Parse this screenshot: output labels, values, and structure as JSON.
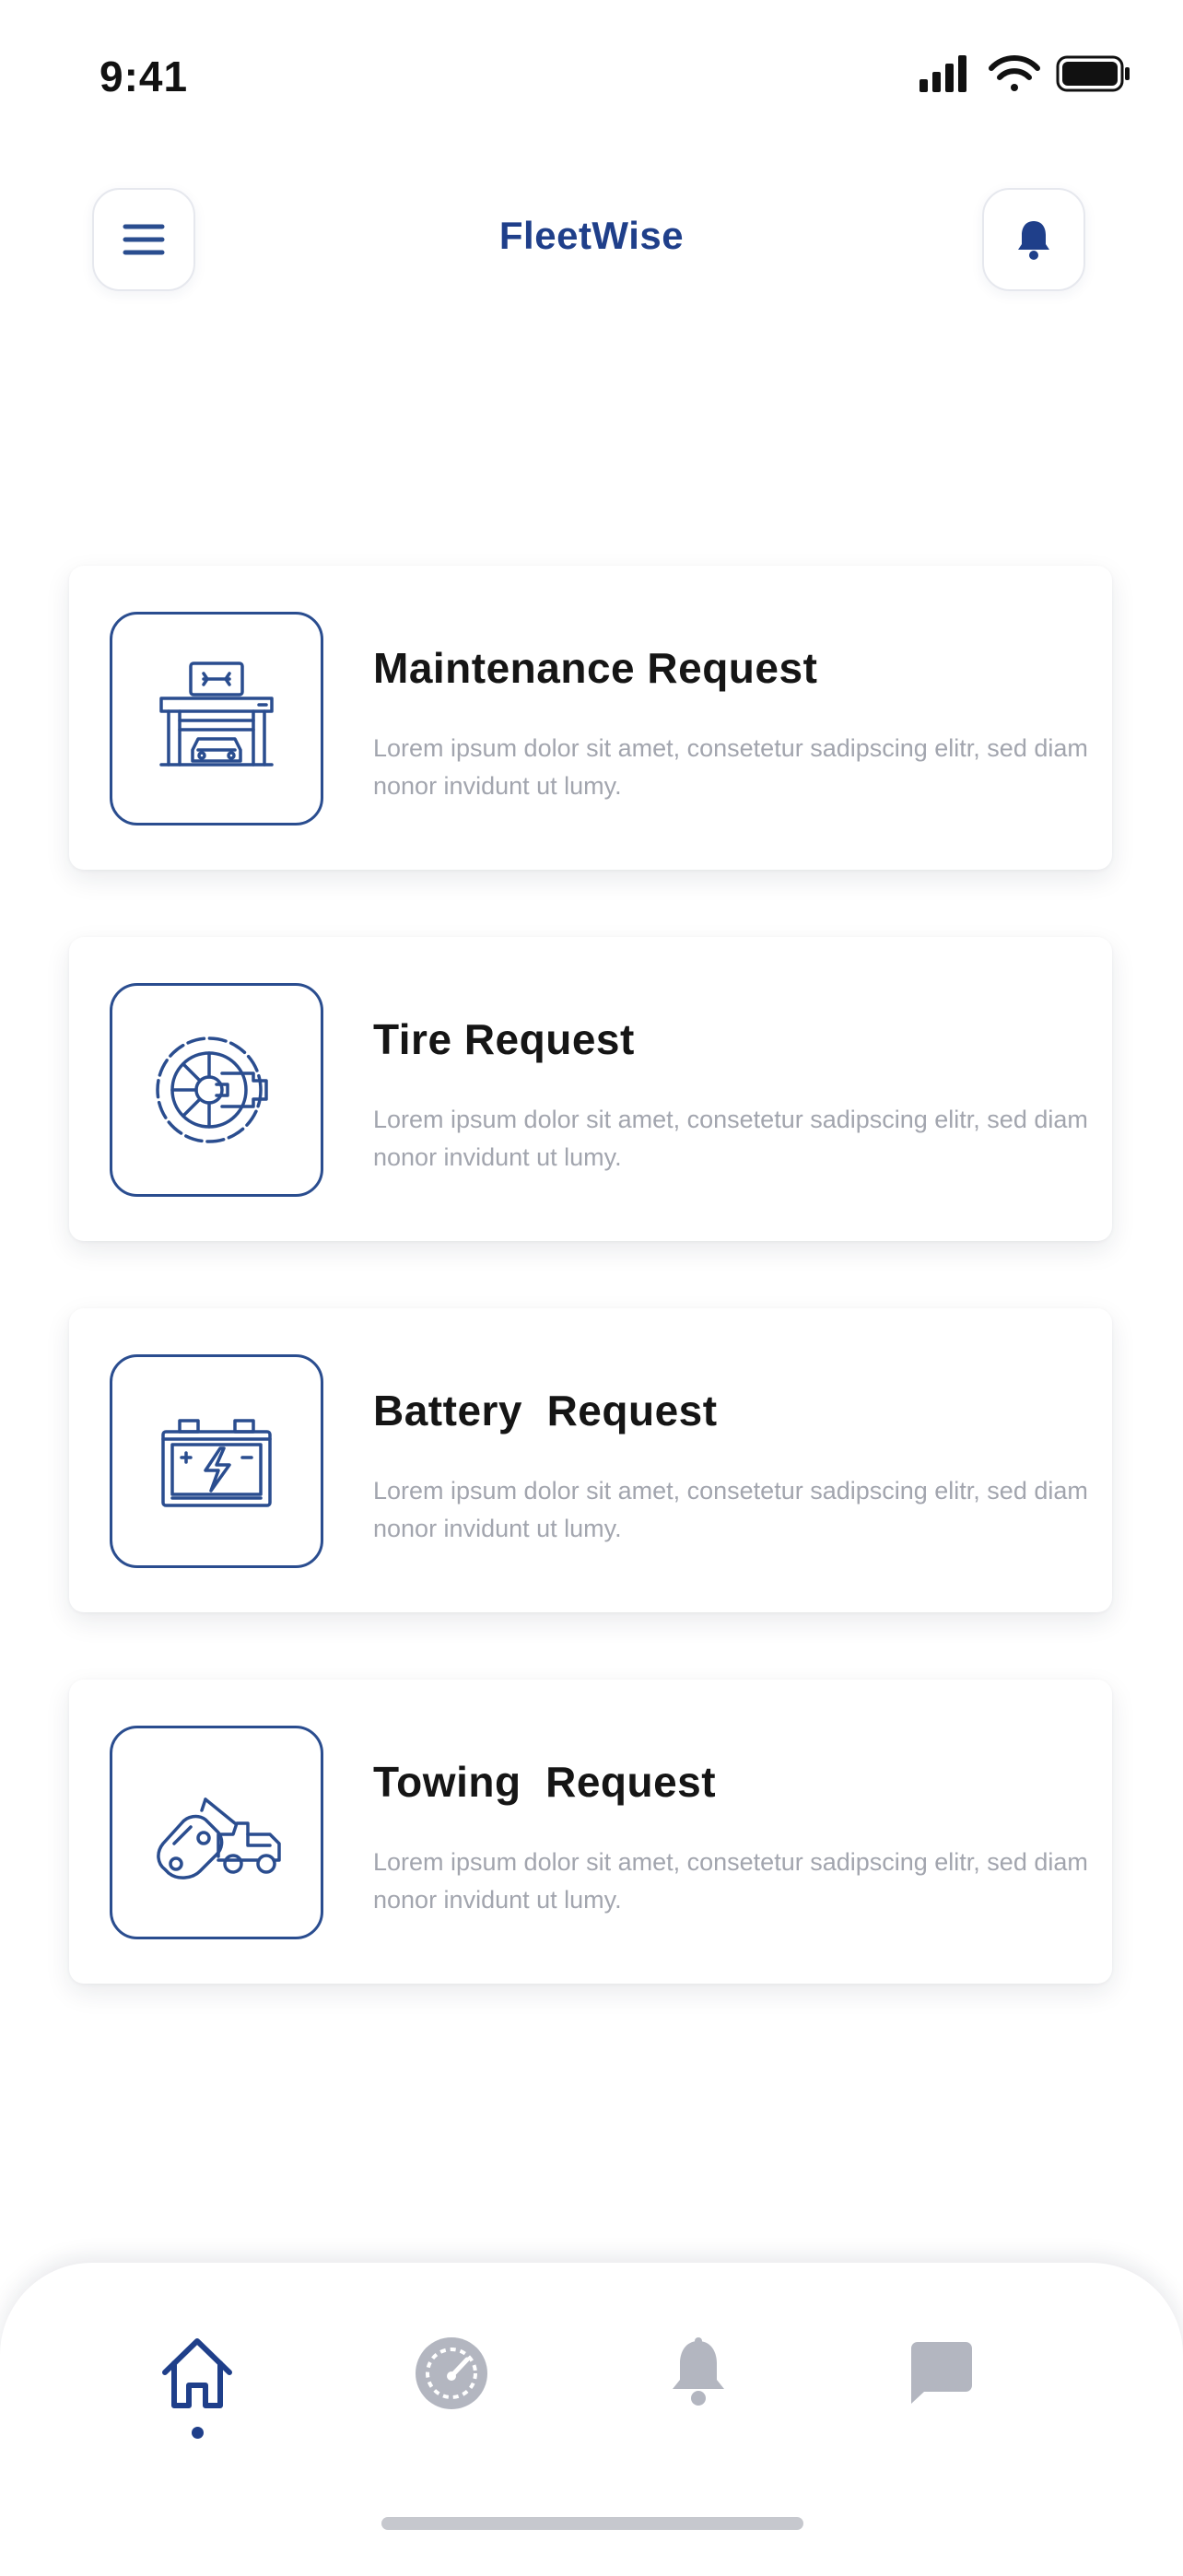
{
  "status_bar": {
    "time": "9:41",
    "icons": [
      "cellular-signal-icon",
      "wifi-icon",
      "battery-icon"
    ]
  },
  "header": {
    "title": "FleetWise",
    "menu_icon": "hamburger-menu-icon",
    "notification_icon": "bell-icon"
  },
  "requests": [
    {
      "title": "Maintenance Request",
      "description": "Lorem ipsum dolor sit amet, consetetur sadipscing elitr, sed diam nonor invidunt ut lumy.",
      "icon": "garage-maintenance-icon"
    },
    {
      "title": "Tire Request",
      "description": "Lorem ipsum dolor sit amet, consetetur sadipscing elitr, sed diam nonor invidunt ut lumy.",
      "icon": "tire-wrench-icon"
    },
    {
      "title": "Battery  Request",
      "description": "Lorem ipsum dolor sit amet, consetetur sadipscing elitr, sed diam nonor invidunt ut lumy.",
      "icon": "car-battery-icon"
    },
    {
      "title": "Towing  Request",
      "description": "Lorem ipsum dolor sit amet, consetetur sadipscing elitr, sed diam nonor invidunt ut lumy.",
      "icon": "tow-truck-icon"
    }
  ],
  "bottom_nav": {
    "items": [
      {
        "icon": "home-icon",
        "active": true
      },
      {
        "icon": "dashboard-gauge-icon",
        "active": false
      },
      {
        "icon": "bell-icon",
        "active": false
      },
      {
        "icon": "chat-icon",
        "active": false
      }
    ]
  },
  "colors": {
    "brand": "#1f3f8a",
    "icon_stroke": "#2a4d8f",
    "inactive_nav": "#b3b6c0",
    "description_text": "#a2a5ae"
  }
}
